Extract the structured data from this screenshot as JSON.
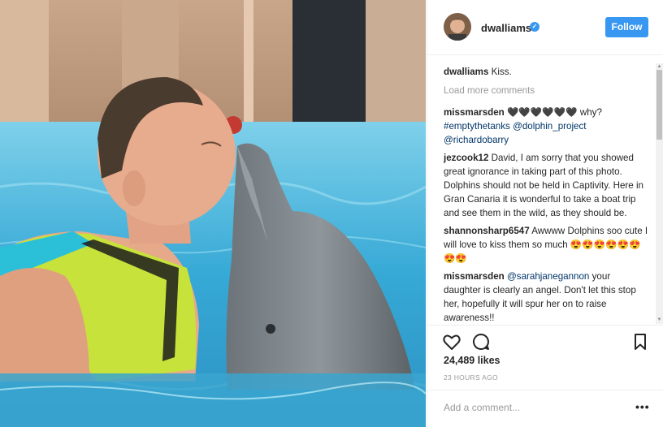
{
  "header": {
    "username": "dwalliams",
    "follow_label": "Follow"
  },
  "caption": {
    "username": "dwalliams",
    "text": "Kiss."
  },
  "load_more": "Load more comments",
  "comments": [
    {
      "username": "missmarsden",
      "text_a": "🖤🖤🖤🖤🖤🖤 why?",
      "mention_1": "#emptythetanks",
      "mention_2": "@dolphin_project",
      "mention_3": "@richardobarry"
    },
    {
      "username": "jezcook12",
      "text": "David, I am sorry that you showed great ignorance in taking part of this photo. Dolphins should not be held in Captivity. Here in Gran Canaria it is wonderful to take a boat trip and see them in the wild, as they should be."
    },
    {
      "username": "shannonsharp6547",
      "text": "Awwww Dolphins soo cute I will love to kiss them so much 😍😍😍😍😍😍😍😍"
    },
    {
      "username": "missmarsden",
      "mention": "@sarahjanegannon",
      "text": "your daughter is clearly an angel. Don't let this stop her, hopefully it will spur her on to raise awareness!!"
    }
  ],
  "likes": "24,489 likes",
  "time_ago": "23 HOURS AGO",
  "add_comment_placeholder": "Add a comment...",
  "more_label": "•••",
  "icons": {
    "like": "heart-icon",
    "comment": "speech-bubble-icon",
    "save": "bookmark-icon",
    "verified": "verified-badge-icon"
  },
  "colors": {
    "accent": "#3897f0",
    "mention": "#003569",
    "muted": "#999999"
  }
}
